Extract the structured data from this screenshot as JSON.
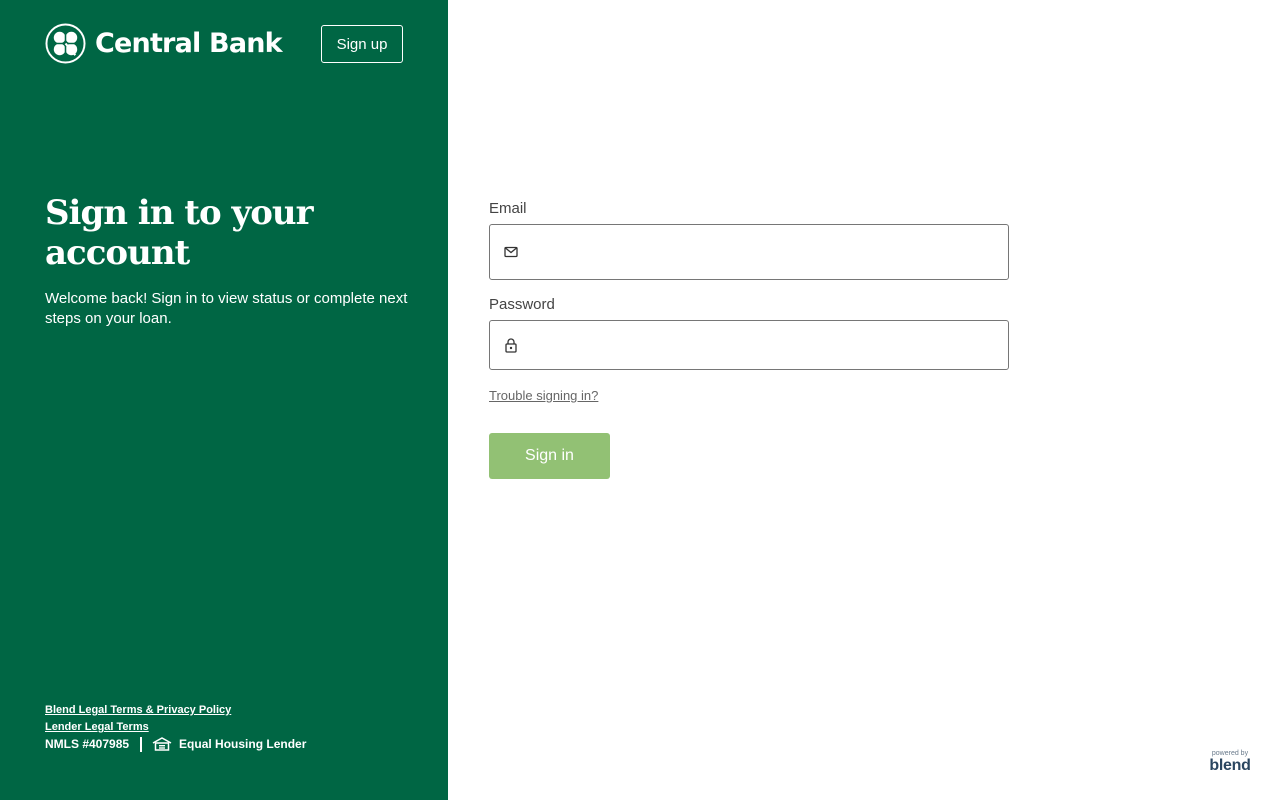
{
  "header": {
    "brand_name": "Central Bank",
    "signup_label": "Sign up"
  },
  "hero": {
    "title": "Sign in to your account",
    "subtitle": "Welcome back! Sign in to view status or complete next steps on your loan."
  },
  "footer": {
    "blend_legal_link": "Blend Legal Terms & Privacy Policy",
    "lender_legal_link": "Lender Legal Terms",
    "nmls": "NMLS #407985",
    "equal_housing": "Equal Housing Lender"
  },
  "form": {
    "email_label": "Email",
    "email_value": "",
    "password_label": "Password",
    "password_value": "",
    "trouble_link": "Trouble signing in?",
    "signin_label": "Sign in"
  },
  "powered_by": {
    "caption": "powered by",
    "brand": "blend"
  },
  "icons": {
    "logo": "clover-logo-icon",
    "email": "mail-icon",
    "password": "lock-icon",
    "equal_housing": "equal-housing-icon"
  },
  "colors": {
    "panel_green": "#006644",
    "signin_button": "#92c174",
    "powered_blend": "#2b4660"
  }
}
